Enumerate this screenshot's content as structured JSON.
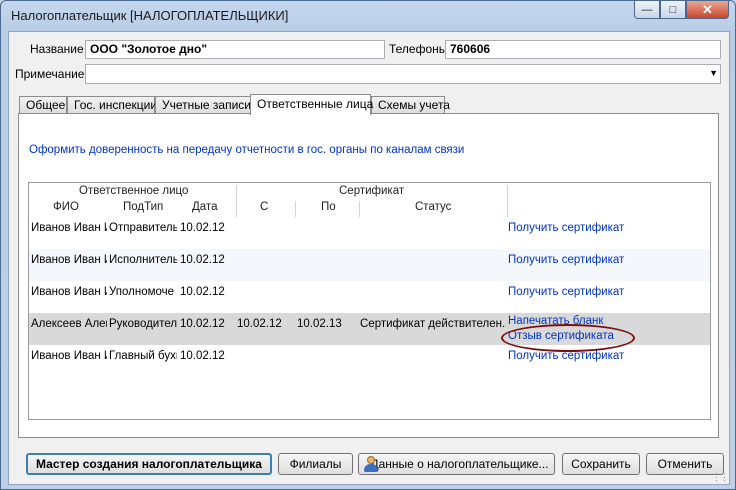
{
  "window": {
    "title": "Налогоплательщик [НАЛОГОПЛАТЕЛЬЩИКИ]"
  },
  "form": {
    "name_label": "Название",
    "name_value": "ООО \"Золотое дно\"",
    "phones_label": "Телефоны",
    "phones_value": "760606",
    "note_label": "Примечание",
    "note_value": ""
  },
  "tabs": [
    {
      "label": "Общее"
    },
    {
      "label": "Гос. инспекции"
    },
    {
      "label": "Учетные записи"
    },
    {
      "label": "Ответственные лица"
    },
    {
      "label": "Схемы учета"
    }
  ],
  "panel": {
    "proxy_link": "Оформить доверенность на передачу отчетности в гос. органы по каналам связи"
  },
  "grid": {
    "group_headers": {
      "person": "Ответственное лицо",
      "certificate": "Сертификат"
    },
    "columns": {
      "fio": "ФИО",
      "subtype": "ПодТип",
      "date": "Дата",
      "from": "С",
      "to": "По",
      "status": "Статус"
    },
    "rows": [
      {
        "fio": "Иванов Иван И",
        "subtype": "Отправитель",
        "date": "10.02.12",
        "from": "",
        "to": "",
        "status": "",
        "links": [
          "Получить сертификат"
        ]
      },
      {
        "fio": "Иванов Иван И",
        "subtype": "Исполнитель",
        "date": "10.02.12",
        "from": "",
        "to": "",
        "status": "",
        "links": [
          "Получить сертификат"
        ]
      },
      {
        "fio": "Иванов Иван И",
        "subtype": "Уполномоче",
        "date": "10.02.12",
        "from": "",
        "to": "",
        "status": "",
        "links": [
          "Получить сертификат"
        ]
      },
      {
        "fio": "Алексеев Алек",
        "subtype": "Руководител",
        "date": "10.02.12",
        "from": "10.02.12",
        "to": "10.02.13",
        "status": "Сертификат действителен.",
        "links": [
          "Напечатать бланк",
          "Отзыв сертификата"
        ]
      },
      {
        "fio": "Иванов Иван И",
        "subtype": "Главный бухг",
        "date": "10.02.12",
        "from": "",
        "to": "",
        "status": "",
        "links": [
          "Получить сертификат"
        ]
      }
    ]
  },
  "buttons": {
    "wizard": "Мастер создания налогоплательщика",
    "branches": "Филиалы",
    "payer_data": "Данные о налогоплательщике...",
    "save": "Сохранить",
    "cancel": "Отменить"
  },
  "icons": {
    "user": "user-icon",
    "dropdown": "chevron-down-icon"
  },
  "colors": {
    "link": "#0033cc",
    "highlight_ellipse": "#7a1010",
    "selected_row": "#d9d9d9"
  }
}
